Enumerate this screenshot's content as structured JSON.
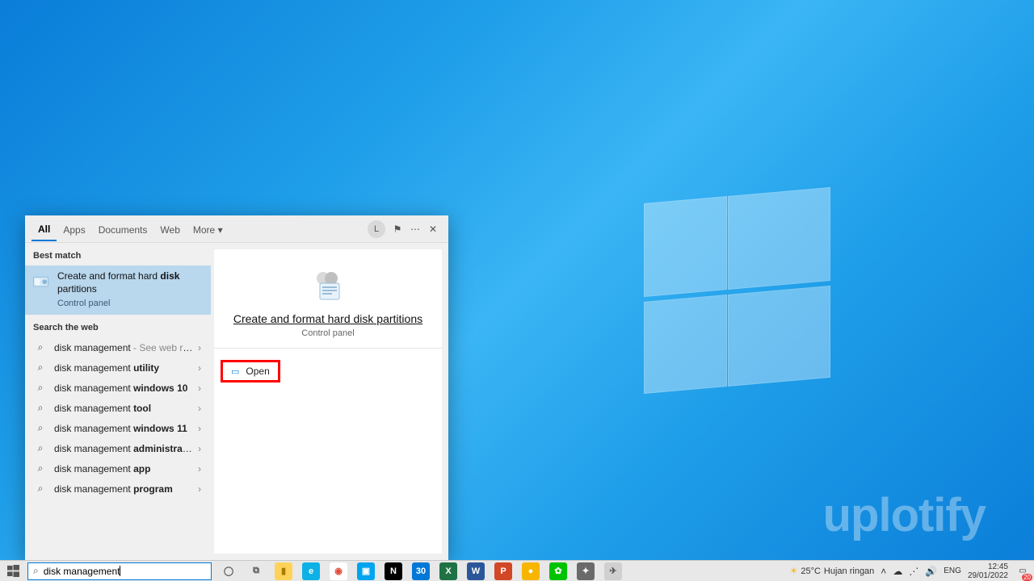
{
  "search_panel": {
    "tabs": [
      "All",
      "Apps",
      "Documents",
      "Web",
      "More"
    ],
    "active_tab": 0,
    "user_initial": "L",
    "left": {
      "best_match_header": "Best match",
      "best_match": {
        "title_prefix": "Create and format hard ",
        "title_bold": "disk",
        "title_suffix_line2": "partitions",
        "subtitle": "Control panel"
      },
      "search_web_header": "Search the web",
      "web_items": [
        {
          "prefix": "disk management",
          "bold": "",
          "suffix": " - See web results",
          "see_web": true
        },
        {
          "prefix": "disk management ",
          "bold": "utility",
          "suffix": ""
        },
        {
          "prefix": "disk management ",
          "bold": "windows 10",
          "suffix": ""
        },
        {
          "prefix": "disk management ",
          "bold": "tool",
          "suffix": ""
        },
        {
          "prefix": "disk management ",
          "bold": "windows 11",
          "suffix": ""
        },
        {
          "prefix": "disk management ",
          "bold": "administrator",
          "suffix": ""
        },
        {
          "prefix": "disk management ",
          "bold": "app",
          "suffix": ""
        },
        {
          "prefix": "disk management ",
          "bold": "program",
          "suffix": ""
        }
      ]
    },
    "right": {
      "title": "Create and format hard disk partitions",
      "subtitle": "Control panel",
      "open_label": "Open"
    }
  },
  "taskbar": {
    "search_value": "disk management",
    "apps": [
      {
        "name": "cortana",
        "bg": "transparent",
        "glyph": "◯",
        "fg": "#555"
      },
      {
        "name": "task-view",
        "bg": "transparent",
        "glyph": "⧉",
        "fg": "#555"
      },
      {
        "name": "file-explorer",
        "bg": "#ffd35a",
        "glyph": "▮",
        "fg": "#aa7b00"
      },
      {
        "name": "edge",
        "bg": "#0db1e6",
        "glyph": "e",
        "fg": "#fff"
      },
      {
        "name": "chrome",
        "bg": "#fff",
        "glyph": "◉",
        "fg": "#e04b3a"
      },
      {
        "name": "ms-store",
        "bg": "#00a4ef",
        "glyph": "▣",
        "fg": "#fff"
      },
      {
        "name": "notion",
        "bg": "#000",
        "glyph": "N",
        "fg": "#fff"
      },
      {
        "name": "calendar",
        "bg": "#0078d7",
        "glyph": "30",
        "fg": "#fff"
      },
      {
        "name": "excel",
        "bg": "#1f7244",
        "glyph": "X",
        "fg": "#fff"
      },
      {
        "name": "word",
        "bg": "#2b579a",
        "glyph": "W",
        "fg": "#fff"
      },
      {
        "name": "powerpoint",
        "bg": "#d24726",
        "glyph": "P",
        "fg": "#fff"
      },
      {
        "name": "app-1",
        "bg": "#f7b500",
        "glyph": "●",
        "fg": "#fff"
      },
      {
        "name": "line",
        "bg": "#00c300",
        "glyph": "✿",
        "fg": "#fff"
      },
      {
        "name": "app-2",
        "bg": "#6a6a6a",
        "glyph": "✦",
        "fg": "#fff"
      },
      {
        "name": "app-3",
        "bg": "#d0d0d0",
        "glyph": "✈",
        "fg": "#555"
      }
    ],
    "weather": {
      "temp": "25°C",
      "desc": "Hujan ringan"
    },
    "lang": "ENG",
    "time": "12:45",
    "date": "29/01/2022",
    "notif_count": "20"
  },
  "watermark": "uplotify"
}
